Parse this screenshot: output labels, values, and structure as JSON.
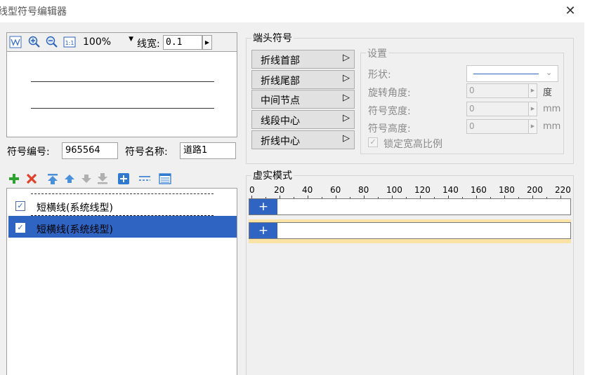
{
  "window": {
    "title": "线型符号编辑器",
    "close_glyph": "✕"
  },
  "preview": {
    "zoom": "100%",
    "line_width_label": "线宽:",
    "line_width_value": "0.1"
  },
  "symbol": {
    "id_label": "符号编号:",
    "id_value": "965564",
    "name_label": "符号名称:",
    "name_value": "道路1"
  },
  "list": {
    "items": [
      {
        "label": "短横线(系统线型)",
        "checked": true,
        "selected": false
      },
      {
        "label": "短横线(系统线型)",
        "checked": true,
        "selected": true
      }
    ]
  },
  "end_symbols": {
    "title": "端头符号",
    "buttons": [
      "折线首部",
      "折线尾部",
      "中间节点",
      "线段中心",
      "折线中心"
    ]
  },
  "settings": {
    "title": "设置",
    "shape_label": "形状:",
    "rotation_label": "旋转角度:",
    "rotation_value": "0",
    "rotation_unit": "度",
    "width_label": "符号宽度:",
    "width_value": "0",
    "width_unit": "mm",
    "height_label": "符号高度:",
    "height_value": "0",
    "height_unit": "mm",
    "lock_label": "锁定宽高比例"
  },
  "dash_pattern": {
    "title": "虚实模式",
    "ruler": [
      "0",
      "20",
      "40",
      "60",
      "80",
      "100",
      "120",
      "140",
      "160",
      "180",
      "200",
      "220"
    ],
    "add_glyph": "+"
  },
  "colors": {
    "selection": "#2f64c3",
    "dialog_bg": "#f0f0f0",
    "highlight": "#fbe3a6"
  }
}
